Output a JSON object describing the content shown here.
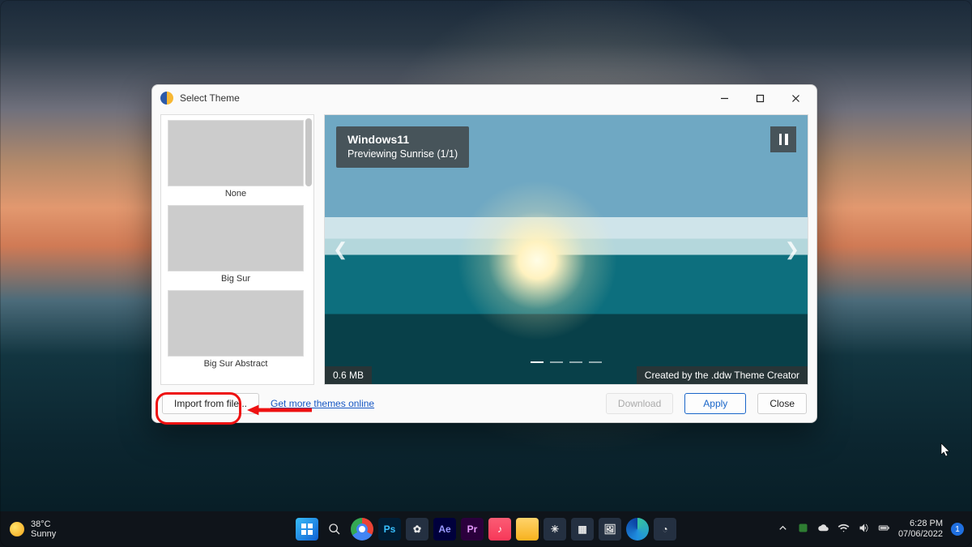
{
  "window": {
    "title": "Select Theme",
    "themes": [
      {
        "label": "None"
      },
      {
        "label": "Big Sur"
      },
      {
        "label": "Big Sur Abstract"
      }
    ],
    "preview": {
      "name": "Windows11",
      "status": "Previewing Sunrise (1/1)",
      "size": "0.6 MB",
      "creator": "Created by the .ddw Theme Creator"
    },
    "footer": {
      "import": "Import from file...",
      "more_link": "Get more themes online",
      "download": "Download",
      "apply": "Apply",
      "close": "Close"
    }
  },
  "taskbar": {
    "weather_temp": "38°C",
    "weather_cond": "Sunny",
    "time": "6:28 PM",
    "date": "07/06/2022",
    "notif_count": "1"
  }
}
